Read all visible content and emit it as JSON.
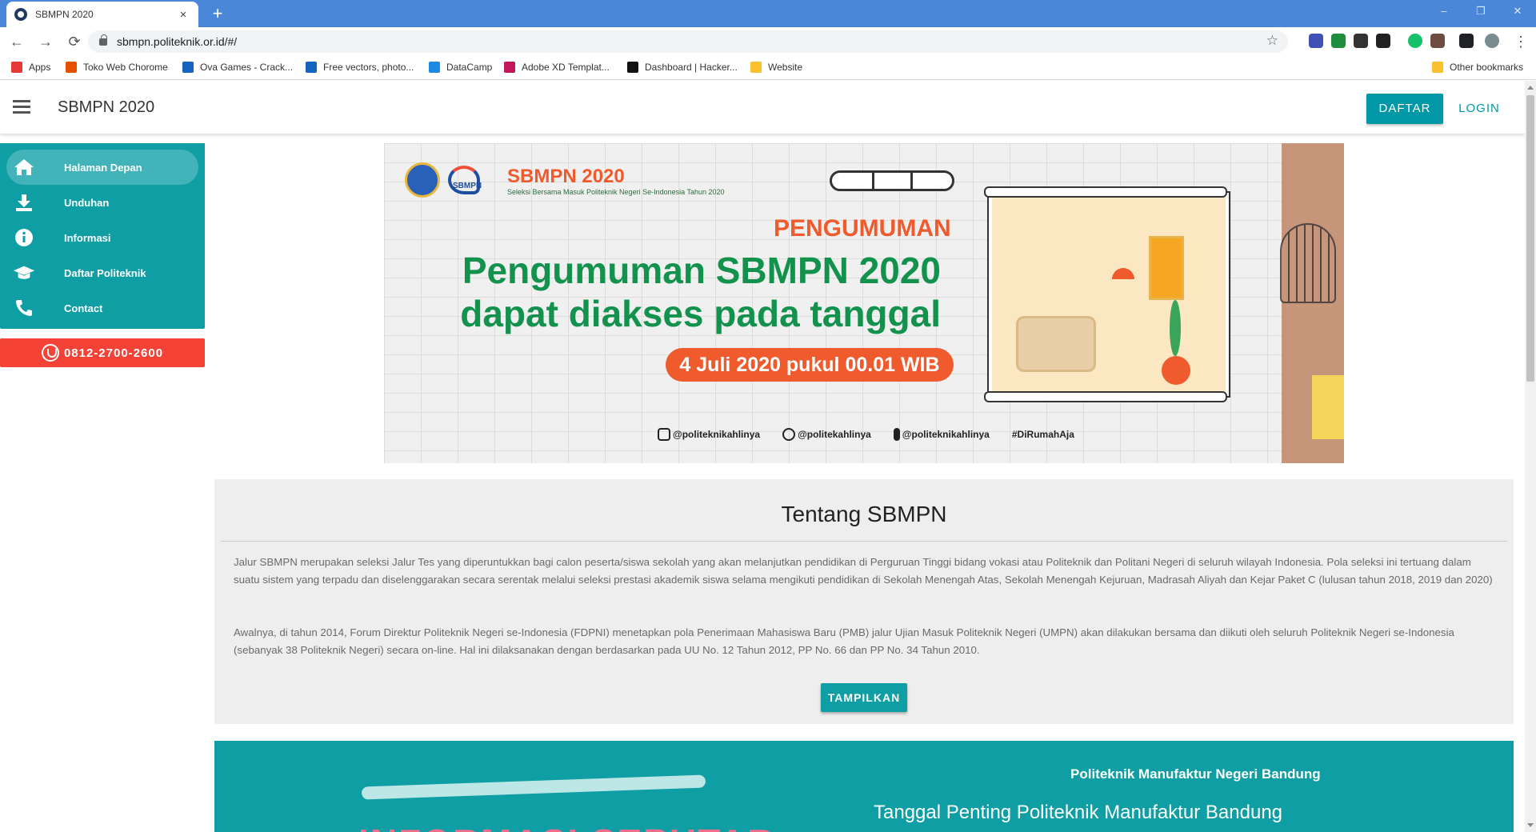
{
  "browser": {
    "tab_title": "SBMPN 2020",
    "tab_close": "×",
    "new_tab": "+",
    "url": "sbmpn.politeknik.or.id/#/",
    "window_controls": [
      "–",
      "❐",
      "✕"
    ],
    "nav": {
      "back": "←",
      "forward": "→",
      "reload": "⟳",
      "star": "☆",
      "menu": "⋮"
    },
    "extensions_colors": [
      "#3f51b5",
      "#1e8e3e",
      "#333333",
      "#222222",
      "#15c26b",
      "#6d4c41",
      "#202124",
      "#7a8b91"
    ],
    "bookmarks": [
      {
        "label": "Apps",
        "color": "#e53935"
      },
      {
        "label": "Toko Web Chorome",
        "color": "#e65100"
      },
      {
        "label": "Ova Games - Crack...",
        "color": "#1565c0"
      },
      {
        "label": "Free vectors, photo...",
        "color": "#1565c0"
      },
      {
        "label": "DataCamp",
        "color": "#1e88e5"
      },
      {
        "label": "Adobe XD Templat...",
        "color": "#c2185b"
      },
      {
        "label": "Dashboard | Hacker...",
        "color": "#111111"
      },
      {
        "label": "Website",
        "color": "#fbc02d"
      }
    ],
    "other_bookmarks": "Other bookmarks"
  },
  "appbar": {
    "brand": "SBMPN 2020",
    "daftar": "DAFTAR",
    "login": "LOGIN"
  },
  "sidebar": {
    "items": [
      {
        "label": "Halaman Depan",
        "icon": "home-icon"
      },
      {
        "label": "Unduhan",
        "icon": "download-icon"
      },
      {
        "label": "Informasi",
        "icon": "info-icon"
      },
      {
        "label": "Daftar Politeknik",
        "icon": "graduation-cap-icon"
      },
      {
        "label": "Contact",
        "icon": "phone-icon"
      }
    ],
    "whatsapp": "0812-2700-2600"
  },
  "banner": {
    "brand_title": "SBMPN 2020",
    "brand_sub": "Seleksi Bersama Masuk Politeknik Negeri Se-Indonesia Tahun 2020",
    "logo_text": "SBMPN",
    "pengumuman": "PENGUMUMAN",
    "headline_1": "Pengumuman SBMPN 2020",
    "headline_2": "dapat diakses pada tanggal",
    "date": "4 Juli 2020 pukul 00.01 WIB",
    "socials": [
      "@politeknikahlinya",
      "@politekahlinya",
      "@politeknikahlinya",
      "#DiRumahAja"
    ]
  },
  "about": {
    "title": "Tentang SBMPN",
    "p1": "Jalur SBMPN merupakan seleksi Jalur Tes yang diperuntukkan bagi calon peserta/siswa sekolah yang akan melanjutkan pendidikan di Perguruan Tinggi bidang vokasi atau Politeknik dan Politani Negeri di seluruh wilayah Indonesia. Pola seleksi ini tertuang dalam suatu sistem yang terpadu dan diselenggarakan secara serentak melalui seleksi prestasi akademik siswa selama mengikuti pendidikan di Sekolah Menengah Atas, Sekolah Menengah Kejuruan, Madrasah Aliyah dan Kejar Paket C (lulusan tahun 2018, 2019 dan 2020)",
    "p2": "Awalnya, di tahun 2014, Forum Direktur Politeknik Negeri se-Indonesia (FDPNI) menetapkan pola Penerimaan Mahasiswa Baru (PMB) jalur Ujian Masuk Politeknik Negeri (UMPN) akan dilakukan bersama dan diikuti oleh seluruh Politeknik Negeri se-Indonesia (sebanyak 38 Politeknik Negeri) secara on-line. Hal ini dilaksanakan dengan berdasarkan pada UU No. 12 Tahun 2012, PP No. 66 dan PP No. 34 Tahun 2010.",
    "button": "TAMPILKAN"
  },
  "info_section": {
    "heading": "INFORMASI SEPUTAR",
    "school": "Politeknik Manufaktur Negeri Bandung",
    "subtitle": "Tanggal Penting Politeknik Manufaktur Bandung"
  }
}
